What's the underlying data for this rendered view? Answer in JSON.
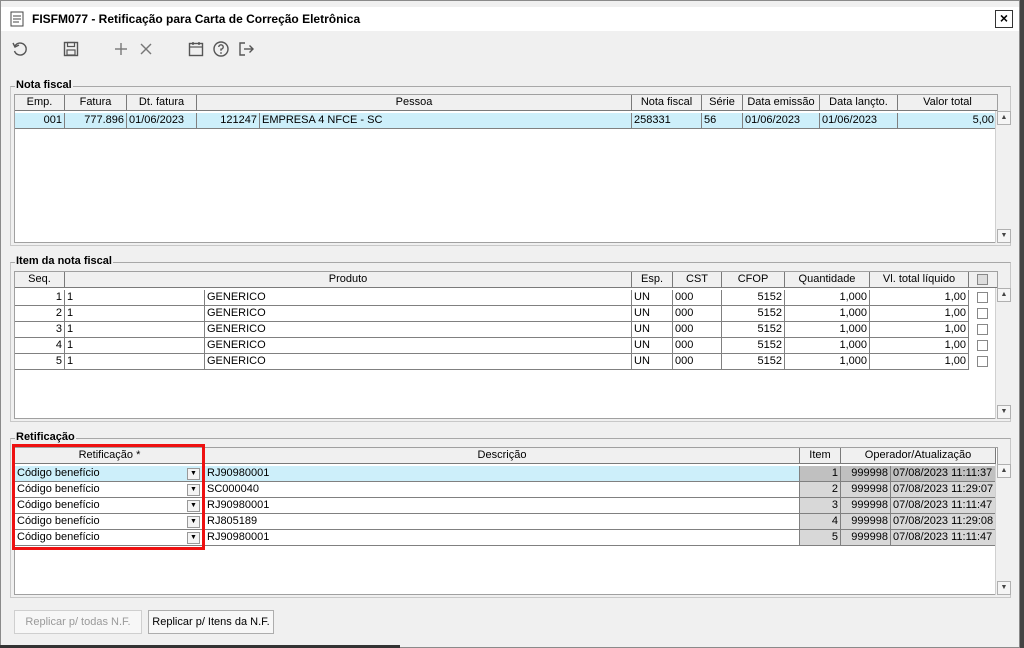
{
  "window": {
    "title": "FISFM077 - Retificação para Carta de Correção Eletrônica",
    "close": "×"
  },
  "toolbar": [
    "refresh-icon",
    "save-icon",
    "add-icon",
    "delete-icon",
    "calendar-icon",
    "help-icon",
    "exit-icon"
  ],
  "nota_fiscal": {
    "label": "Nota fiscal",
    "headers": [
      "Emp.",
      "Fatura",
      "Dt. fatura",
      "Pessoa",
      "Nota fiscal",
      "Série",
      "Data emissão",
      "Data lançto.",
      "Valor total"
    ],
    "rows": [
      {
        "emp": "001",
        "fatura": "777.896",
        "dt_fatura": "01/06/2023",
        "pessoa_cod": "121247",
        "pessoa_nome": "EMPRESA 4 NFCE - SC",
        "nota": "258331",
        "serie": "56",
        "emissao": "01/06/2023",
        "lancto": "01/06/2023",
        "valor": "5,00"
      }
    ]
  },
  "item_nf": {
    "label": "Item da nota fiscal",
    "headers": [
      "Seq.",
      "Produto",
      "Esp.",
      "CST",
      "CFOP",
      "Quantidade",
      "Vl. total líquido"
    ],
    "rows": [
      {
        "seq": "1",
        "prod_cod": "1",
        "prod_nome": "GENERICO",
        "esp": "UN",
        "cst": "000",
        "cfop": "5152",
        "qtd": "1,000",
        "valor": "1,00"
      },
      {
        "seq": "2",
        "prod_cod": "1",
        "prod_nome": "GENERICO",
        "esp": "UN",
        "cst": "000",
        "cfop": "5152",
        "qtd": "1,000",
        "valor": "1,00"
      },
      {
        "seq": "3",
        "prod_cod": "1",
        "prod_nome": "GENERICO",
        "esp": "UN",
        "cst": "000",
        "cfop": "5152",
        "qtd": "1,000",
        "valor": "1,00"
      },
      {
        "seq": "4",
        "prod_cod": "1",
        "prod_nome": "GENERICO",
        "esp": "UN",
        "cst": "000",
        "cfop": "5152",
        "qtd": "1,000",
        "valor": "1,00"
      },
      {
        "seq": "5",
        "prod_cod": "1",
        "prod_nome": "GENERICO",
        "esp": "UN",
        "cst": "000",
        "cfop": "5152",
        "qtd": "1,000",
        "valor": "1,00"
      }
    ]
  },
  "retificacao": {
    "label": "Retificação",
    "headers": [
      "Retificação *",
      "Descrição",
      "Item",
      "Operador/Atualização"
    ],
    "rows": [
      {
        "tipo": "Código benefício",
        "descricao": "RJ90980001",
        "item": "1",
        "operador": "999998",
        "atualizacao": "07/08/2023 11:11:37"
      },
      {
        "tipo": "Código benefício",
        "descricao": "SC000040",
        "item": "2",
        "operador": "999998",
        "atualizacao": "07/08/2023 11:29:07"
      },
      {
        "tipo": "Código benefício",
        "descricao": "RJ90980001",
        "item": "3",
        "operador": "999998",
        "atualizacao": "07/08/2023 11:11:47"
      },
      {
        "tipo": "Código benefício",
        "descricao": "RJ805189",
        "item": "4",
        "operador": "999998",
        "atualizacao": "07/08/2023 11:29:08"
      },
      {
        "tipo": "Código benefício",
        "descricao": "RJ90980001",
        "item": "5",
        "operador": "999998",
        "atualizacao": "07/08/2023 11:11:47"
      }
    ]
  },
  "buttons": {
    "replicar_todas": "Replicar p/ todas N.F.",
    "replicar_itens": "Replicar p/ Itens da N.F."
  }
}
